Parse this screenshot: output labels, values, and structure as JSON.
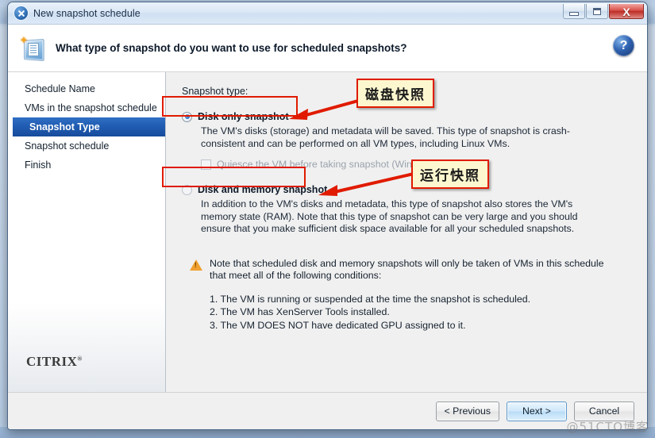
{
  "window": {
    "title": "New snapshot schedule",
    "minimize_label": "Minimize",
    "maximize_label": "Maximize",
    "close_label": "X"
  },
  "header": {
    "title": "What type of snapshot do you want to use for scheduled snapshots?",
    "help_label": "?"
  },
  "sidebar": {
    "items": [
      {
        "label": "Schedule Name",
        "active": false
      },
      {
        "label": "VMs in the snapshot schedule",
        "active": false
      },
      {
        "label": "Snapshot Type",
        "active": true
      },
      {
        "label": "Snapshot schedule",
        "active": false
      },
      {
        "label": "Finish",
        "active": false
      }
    ],
    "logo": "CITRIX",
    "logo_mark": "®"
  },
  "content": {
    "snapshot_type_label": "Snapshot type:",
    "option_disk_only": {
      "label_pre": "D",
      "label_underline": "",
      "label": "Disk only snapshot",
      "selected": true,
      "description": "The VM's disks (storage) and metadata will be saved. This type of snapshot is crash-consistent and can be performed on all VM types, including Linux VMs."
    },
    "quiesce": {
      "label": "Quiesce the VM before taking snapshot (Windo",
      "checked": false,
      "enabled": false
    },
    "option_disk_memory": {
      "label": "Disk and memory snapshot",
      "selected": false,
      "description": "In addition to the VM's disks and metadata, this type of snapshot also stores the VM's memory state (RAM). Note that this type of snapshot can be very large and you should ensure that you make sufficient disk space available for all your scheduled snapshots."
    },
    "note": {
      "text": "Note that scheduled disk and memory snapshots will only be taken of VMs in this schedule that meet all of the following conditions:",
      "conditions": [
        "1. The VM is running or suspended at the time the snapshot is scheduled.",
        "2. The VM has XenServer Tools installed.",
        "3. The VM DOES NOT have dedicated GPU assigned to it."
      ]
    }
  },
  "footer": {
    "previous": "< Previous",
    "next": "Next >",
    "cancel": "Cancel"
  },
  "annotations": [
    {
      "text": "磁盘快照"
    },
    {
      "text": "运行快照"
    }
  ],
  "watermark": "@51CTO博客",
  "colors": {
    "accent": "#1f5bb0",
    "annotation_border": "#e01b00",
    "annotation_fill": "#fdf7cf",
    "warning": "#f0a030"
  }
}
